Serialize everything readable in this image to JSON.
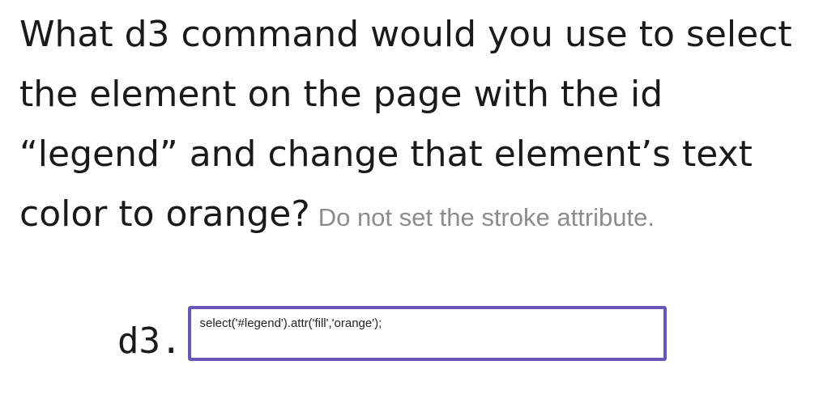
{
  "question": {
    "line1": "What d3 command would you use to select",
    "line2": "the element on the page with the id",
    "line3": "“legend” and change that element’s text",
    "line4": "color to orange?",
    "hint": "Do not set the stroke attribute."
  },
  "answer": {
    "prefix": "d3.",
    "value": "select('#legend').attr('fill','orange');"
  },
  "colors": {
    "input_border": "#6a56b3",
    "hint_text": "#8c8c8c"
  }
}
